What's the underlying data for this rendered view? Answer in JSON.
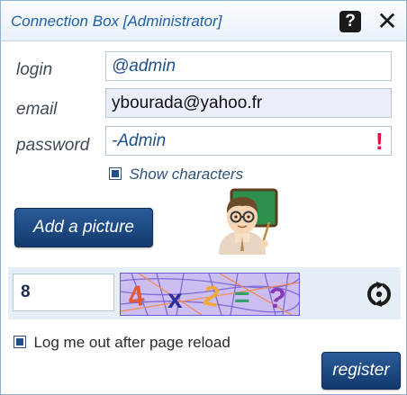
{
  "dialog": {
    "title": "Connection Box [Administrator]",
    "help_icon": "question-mark-icon",
    "help_glyph": "?",
    "close_icon": "close-x-icon",
    "close_glyph": "✕"
  },
  "form": {
    "login_label": "login",
    "login_value": "@admin",
    "email_label": "email",
    "email_value": "ybourada@yahoo.fr",
    "password_label": "password",
    "password_value": "-Admin",
    "warning_glyph": "!",
    "show_characters_label": "Show characters",
    "show_characters_checked": true
  },
  "picture": {
    "add_picture_label": "Add a picture",
    "avatar_icon": "teacher-emoji-icon"
  },
  "captcha": {
    "answer_value": "8",
    "image_text": "4 x 2 = ?",
    "refresh_icon": "refresh-cycle-icon"
  },
  "footer": {
    "logout_label": "Log me out after page reload",
    "logout_checked": true,
    "register_label": "register"
  },
  "colors": {
    "accent": "#1f5fa6",
    "button": "#1c4a82",
    "warning": "#e0103a",
    "captcha_bg": "#cdbef2"
  }
}
